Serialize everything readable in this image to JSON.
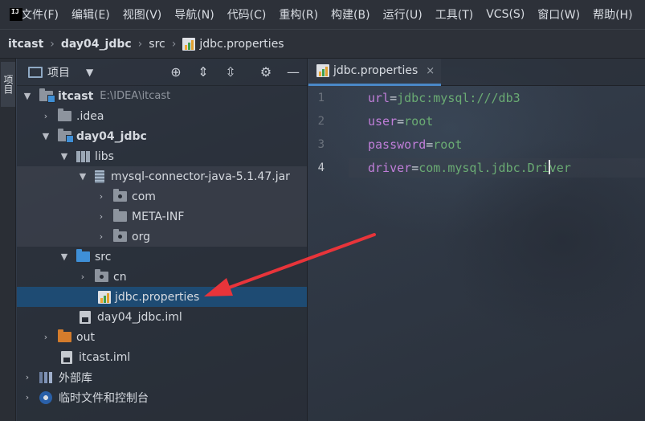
{
  "menubar": {
    "logo_text": "IJ",
    "items": [
      "文件(F)",
      "编辑(E)",
      "视图(V)",
      "导航(N)",
      "代码(C)",
      "重构(R)",
      "构建(B)",
      "运行(U)",
      "工具(T)",
      "VCS(S)",
      "窗口(W)",
      "帮助(H)"
    ]
  },
  "breadcrumb": {
    "items": [
      "itcast",
      "day04_jdbc",
      "src",
      "jdbc.properties"
    ]
  },
  "side_strip": {
    "tab_label": "项目"
  },
  "project_panel": {
    "title": "项目",
    "tools": [
      "crosshair-icon",
      "expand-all-icon",
      "collapse-all-icon",
      "gear-icon",
      "minimize-icon"
    ],
    "tree": [
      {
        "label": "itcast",
        "path": "E:\\IDEA\\itcast",
        "depth": 0,
        "expanded": true,
        "icon": "module-folder"
      },
      {
        "label": ".idea",
        "depth": 1,
        "expanded": false,
        "icon": "folder"
      },
      {
        "label": "day04_jdbc",
        "depth": 1,
        "expanded": true,
        "icon": "module-folder"
      },
      {
        "label": "libs",
        "depth": 2,
        "expanded": true,
        "icon": "libs"
      },
      {
        "label": "mysql-connector-java-5.1.47.jar",
        "depth": 3,
        "expanded": true,
        "icon": "jar"
      },
      {
        "label": "com",
        "depth": 4,
        "expanded": false,
        "icon": "package"
      },
      {
        "label": "META-INF",
        "depth": 4,
        "expanded": false,
        "icon": "folder"
      },
      {
        "label": "org",
        "depth": 4,
        "expanded": false,
        "icon": "package"
      },
      {
        "label": "src",
        "depth": 2,
        "expanded": true,
        "icon": "source-folder"
      },
      {
        "label": "cn",
        "depth": 3,
        "expanded": false,
        "icon": "package"
      },
      {
        "label": "jdbc.properties",
        "depth": 3,
        "leaf": true,
        "icon": "properties",
        "selected": true
      },
      {
        "label": "day04_jdbc.iml",
        "depth": 2,
        "leaf": true,
        "icon": "iml"
      },
      {
        "label": "out",
        "depth": 1,
        "expanded": false,
        "icon": "excluded-folder"
      },
      {
        "label": "itcast.iml",
        "depth": 1,
        "leaf": true,
        "icon": "iml"
      },
      {
        "label": "外部库",
        "depth": 0,
        "expanded": false,
        "icon": "external-libraries"
      },
      {
        "label": "临时文件和控制台",
        "depth": 0,
        "expanded": false,
        "icon": "scratches"
      }
    ]
  },
  "editor": {
    "tab": {
      "label": "jdbc.properties",
      "close": "×"
    },
    "lines": [
      {
        "no": "1",
        "key": "url",
        "eq": "=",
        "value": "jdbc:mysql:///db3"
      },
      {
        "no": "2",
        "key": "user",
        "eq": "=",
        "value": "root"
      },
      {
        "no": "3",
        "key": "password",
        "eq": "=",
        "value": "root"
      },
      {
        "no": "4",
        "key": "driver",
        "eq": "=",
        "value_before_caret": "com.mysql.jdbc.Dri",
        "value_after_caret": "ver",
        "current": true
      }
    ]
  },
  "colors": {
    "selection": "#1e4b73",
    "key": "#c07ed9",
    "value": "#6aab73",
    "arrow": "#e8343a"
  }
}
